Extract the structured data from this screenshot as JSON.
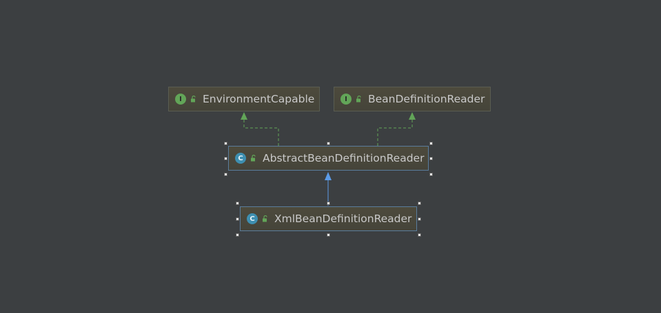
{
  "colors": {
    "background": "#3c3f41",
    "interface_badge": "#62a558",
    "class_badge": "#3e8fb0",
    "dashed_edge": "#62a558",
    "solid_edge": "#5b9be8",
    "node_text": "#c9c9c9"
  },
  "nodes": {
    "environment_capable": {
      "badge": "I",
      "label": "EnvironmentCapable",
      "kind": "interface"
    },
    "bean_definition_reader": {
      "badge": "I",
      "label": "BeanDefinitionReader",
      "kind": "interface"
    },
    "abstract_bean_definition_reader": {
      "badge": "C",
      "label": "AbstractBeanDefinitionReader",
      "kind": "abstract-class"
    },
    "xml_bean_definition_reader": {
      "badge": "C",
      "label": "XmlBeanDefinitionReader",
      "kind": "class"
    }
  },
  "edges": [
    {
      "from": "AbstractBeanDefinitionReader",
      "to": "EnvironmentCapable",
      "relation": "implements"
    },
    {
      "from": "AbstractBeanDefinitionReader",
      "to": "BeanDefinitionReader",
      "relation": "implements"
    },
    {
      "from": "XmlBeanDefinitionReader",
      "to": "AbstractBeanDefinitionReader",
      "relation": "extends"
    }
  ]
}
